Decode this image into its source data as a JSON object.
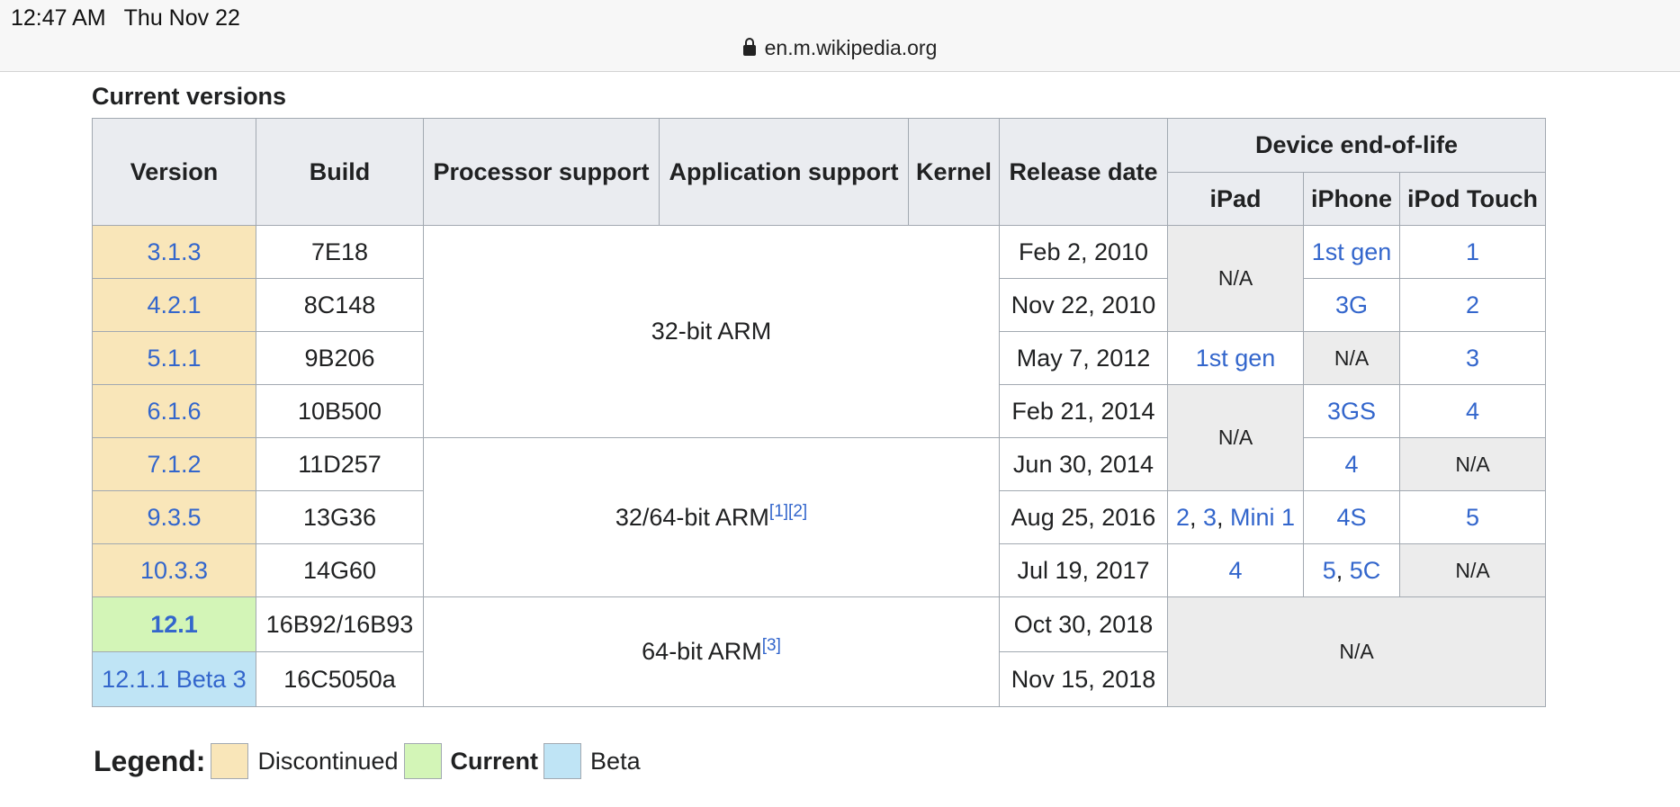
{
  "status_bar": {
    "time": "12:47 AM",
    "date": "Thu Nov 22"
  },
  "address_bar": {
    "url": "en.m.wikipedia.org"
  },
  "caption": "Current versions",
  "headers": {
    "version": "Version",
    "build": "Build",
    "processor": "Processor support",
    "application": "Application support",
    "kernel": "Kernel",
    "release": "Release date",
    "eol": "Device end-of-life",
    "ipad": "iPad",
    "iphone": "iPhone",
    "ipod": "iPod Touch"
  },
  "rows": [
    {
      "version": "3.1.3",
      "build": "7E18",
      "release": "Feb 2, 2010",
      "iphone": "1st gen",
      "ipod": "1"
    },
    {
      "version": "4.2.1",
      "build": "8C148",
      "release": "Nov 22, 2010",
      "iphone": "3G",
      "ipod": "2"
    },
    {
      "version": "5.1.1",
      "build": "9B206",
      "release": "May 7, 2012",
      "ipad": "1st gen",
      "iphone": "N/A",
      "ipod": "3"
    },
    {
      "version": "6.1.6",
      "build": "10B500",
      "release": "Feb 21, 2014",
      "iphone": "3GS",
      "ipod": "4"
    },
    {
      "version": "7.1.2",
      "build": "11D257",
      "release": "Jun 30, 2014",
      "iphone": "4",
      "ipod": "N/A"
    },
    {
      "version": "9.3.5",
      "build": "13G36",
      "release": "Aug 25, 2016",
      "ipad_links": [
        "2",
        "3",
        "Mini 1"
      ],
      "iphone": "4S",
      "ipod": "5"
    },
    {
      "version": "10.3.3",
      "build": "14G60",
      "release": "Jul 19, 2017",
      "ipad": "4",
      "iphone_links": [
        "5",
        "5C"
      ],
      "ipod": "N/A"
    },
    {
      "version": "12.1",
      "build": "16B92/16B93",
      "release": "Oct 30, 2018"
    },
    {
      "version": "12.1.1 Beta 3",
      "build": "16C5050a",
      "release": "Nov 15, 2018"
    }
  ],
  "merged": {
    "arch_32": "32-bit ARM",
    "arch_3264": "32/64-bit ARM",
    "arch_3264_refs": [
      "[1]",
      "[2]"
    ],
    "arch_64": "64-bit ARM",
    "arch_64_refs": [
      "[3]"
    ],
    "ipad_na_1": "N/A",
    "ipad_na_2": "N/A",
    "eol_na": "N/A"
  },
  "legend": {
    "title": "Legend:",
    "items": [
      {
        "label": "Discontinued",
        "color": "#f9e6b9"
      },
      {
        "label": "Current",
        "color": "#d3f5b7"
      },
      {
        "label": "Beta",
        "color": "#bfe4f5"
      }
    ]
  },
  "colors": {
    "link": "#3366cc",
    "header_bg": "#eaecf0",
    "na_bg": "#ececec",
    "border": "#a2a9b1"
  }
}
